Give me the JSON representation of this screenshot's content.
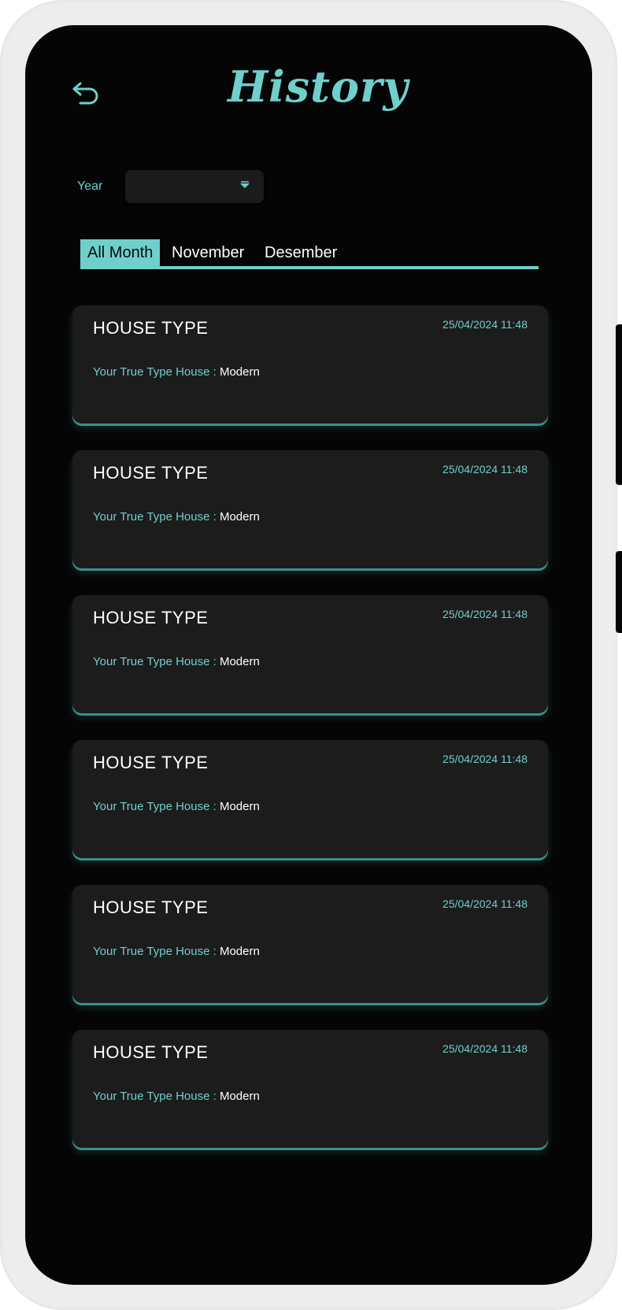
{
  "header": {
    "title": "History",
    "back_icon": "undo-arrow-icon"
  },
  "filter": {
    "year_label": "Year",
    "year_value": "",
    "dropdown_icon": "caret-down-icon"
  },
  "tabs": [
    {
      "label": "All Month",
      "active": true
    },
    {
      "label": "November",
      "active": false
    },
    {
      "label": "Desember",
      "active": false
    }
  ],
  "cards": [
    {
      "title": "HOUSE TYPE",
      "date": "25/04/2024 11:48",
      "label": "Your True Type House :",
      "value": "Modern"
    },
    {
      "title": "HOUSE TYPE",
      "date": "25/04/2024 11:48",
      "label": "Your True Type House :",
      "value": "Modern"
    },
    {
      "title": "HOUSE TYPE",
      "date": "25/04/2024 11:48",
      "label": "Your True Type House :",
      "value": "Modern"
    },
    {
      "title": "HOUSE TYPE",
      "date": "25/04/2024 11:48",
      "label": "Your True Type House :",
      "value": "Modern"
    },
    {
      "title": "HOUSE TYPE",
      "date": "25/04/2024 11:48",
      "label": "Your True Type House :",
      "value": "Modern"
    },
    {
      "title": "HOUSE TYPE",
      "date": "25/04/2024 11:48",
      "label": "Your True Type House :",
      "value": "Modern"
    }
  ],
  "colors": {
    "accent": "#6fcfcb",
    "background": "#050505",
    "card": "#1c1c1c"
  }
}
